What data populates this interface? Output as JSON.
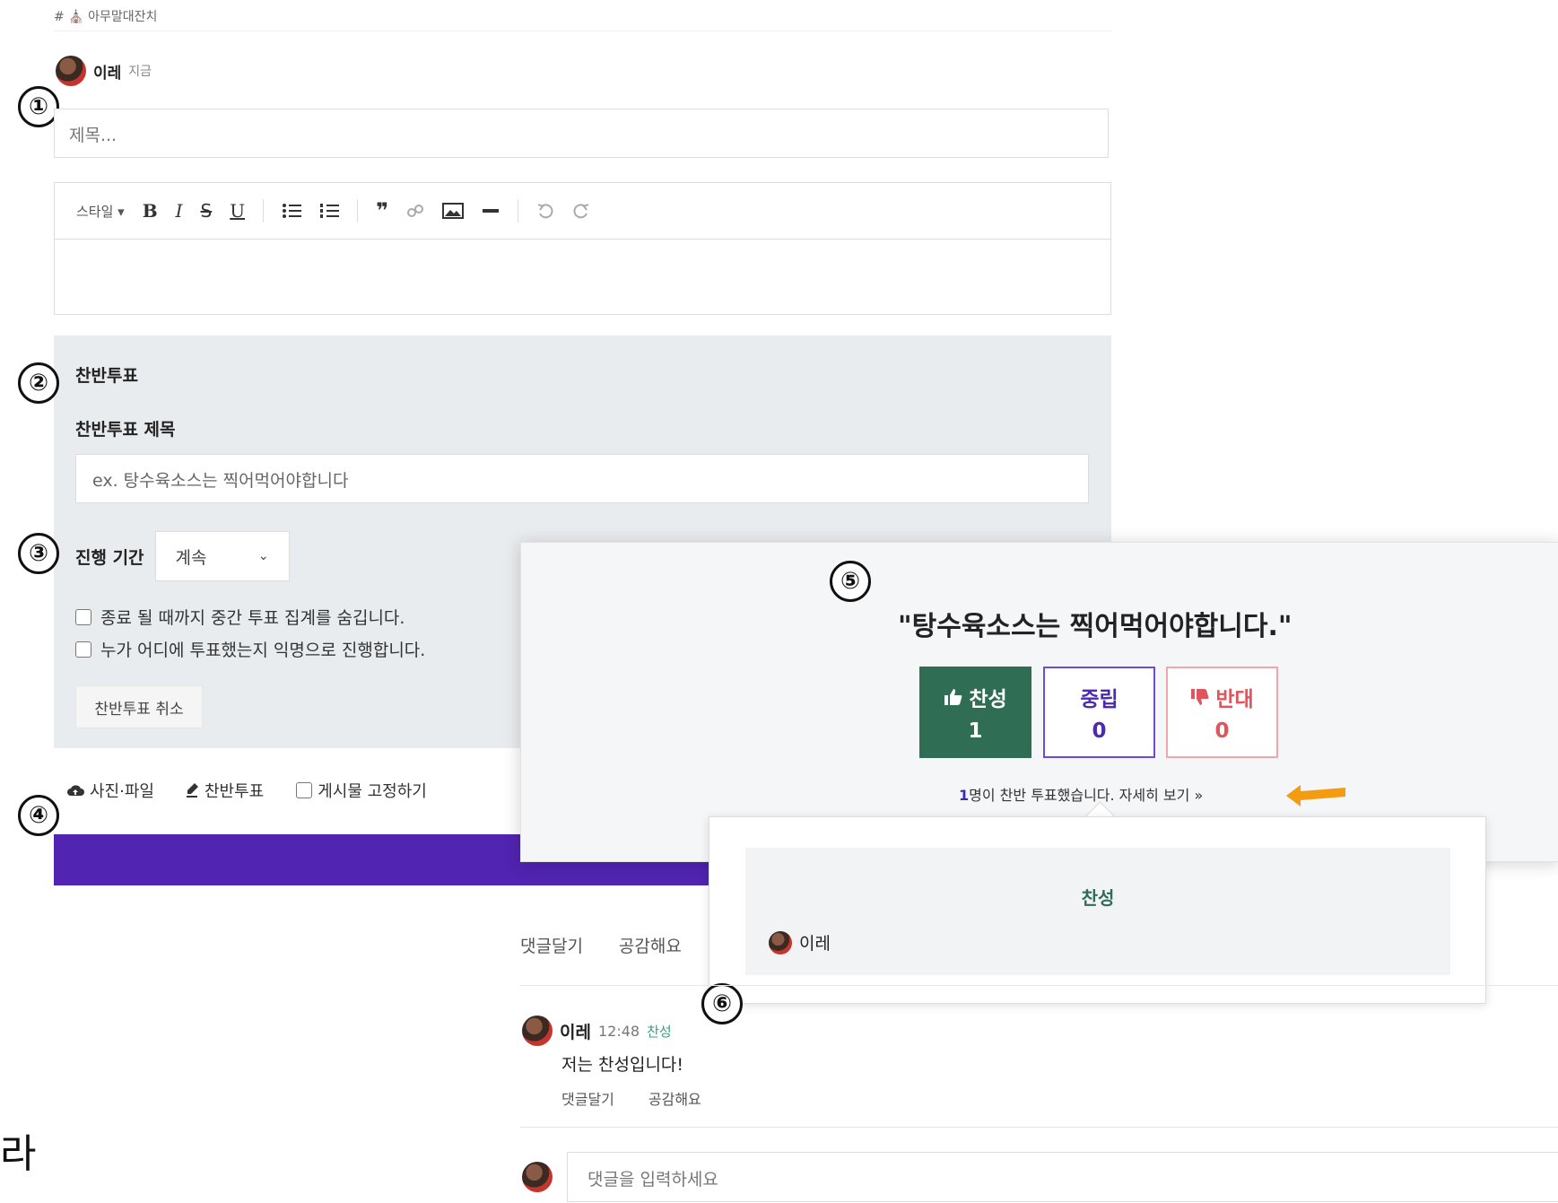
{
  "channel": {
    "label": "# ⛪ 아무말대잔치"
  },
  "post": {
    "author": "이레",
    "time": "지금",
    "title_placeholder": "제목..."
  },
  "editor_toolbar": {
    "style_label": "스타일 ▾",
    "bold": "B",
    "italic": "I",
    "strike": "S",
    "underline": "U",
    "quote": "❞"
  },
  "vote_form": {
    "section_title": "찬반투표",
    "title_label": "찬반투표 제목",
    "title_placeholder": "ex. 탕수육소스는 찍어먹어야합니다",
    "period_label": "진행 기간",
    "period_value": "계속",
    "hide_results_label": "종료 될 때까지 중간 투표 집계를 숨깁니다.",
    "anonymous_label": "누가 어디에 투표했는지 익명으로 진행합니다.",
    "cancel_label": "찬반투표 취소"
  },
  "attach_bar": {
    "photo_file": "사진·파일",
    "vote": "찬반투표",
    "pin": "게시물 고정하기"
  },
  "annotations": [
    "①",
    "②",
    "③",
    "④",
    "⑤",
    "⑥"
  ],
  "vote_card": {
    "title": "\"탕수육소스는 찍어먹어야합니다.\"",
    "options": [
      {
        "label": "찬성",
        "count": "1"
      },
      {
        "label": "중립",
        "count": "0"
      },
      {
        "label": "반대",
        "count": "0"
      }
    ],
    "summary_count": "1",
    "summary_text": "명이 찬반 투표했습니다. 자세히 보기 »",
    "accent_color": "#f39c12"
  },
  "voters_popup": {
    "heading": "찬성",
    "voter": "이레"
  },
  "post_actions": {
    "comment": "댓글달기",
    "like": "공감해요"
  },
  "comment": {
    "author": "이레",
    "time": "12:48",
    "tag": "찬성",
    "text": "저는 찬성입니다!",
    "reply": "댓글달기",
    "like": "공감해요"
  },
  "reply_box": {
    "placeholder": "댓글을 입력하세요"
  },
  "side_text": "라",
  "colors": {
    "primary": "#5124b1",
    "for": "#2f6e55",
    "neutral": "#6d4ad9",
    "against": "#e0555d"
  }
}
